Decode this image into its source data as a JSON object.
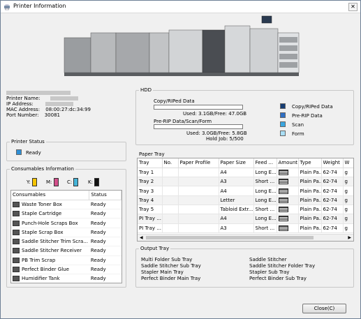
{
  "window": {
    "title": "Printer Information",
    "close_glyph": "✕"
  },
  "printer_info": {
    "name_label": "Printer Name:",
    "ip_label": "IP Address:",
    "mac_label": "MAC Address:",
    "mac_value": "08:00:27:dc:34:99",
    "port_label": "Port Number:",
    "port_value": "30081"
  },
  "printer_status": {
    "title": "Printer Status",
    "value": "Ready",
    "color": "#2e8fd6"
  },
  "consumables_info": {
    "title": "Consumables Information",
    "toners": [
      {
        "label": "Y:",
        "color": "#f5c400"
      },
      {
        "label": "M:",
        "color": "#d24f8a"
      },
      {
        "label": "C:",
        "color": "#45b4d8"
      },
      {
        "label": "K:",
        "color": "#111111"
      }
    ],
    "columns": [
      "Consumables",
      "Status"
    ],
    "rows": [
      {
        "name": "Waste Toner Box",
        "status": "Ready"
      },
      {
        "name": "Staple Cartridge",
        "status": "Ready"
      },
      {
        "name": "Punch-Hole Scraps Box",
        "status": "Ready"
      },
      {
        "name": "Staple Scrap Box",
        "status": "Ready"
      },
      {
        "name": "Saddle Stitcher Trim Scra...",
        "status": "Ready"
      },
      {
        "name": "Saddle Stitcher Receiver",
        "status": "Ready"
      },
      {
        "name": "PB Trim Scrap",
        "status": "Ready"
      },
      {
        "name": "Perfect Binder Glue",
        "status": "Ready"
      },
      {
        "name": "Humidifier Tank",
        "status": "Ready"
      }
    ]
  },
  "hdd": {
    "title": "HDD",
    "copy_ripped_label": "Copy/RIPed Data",
    "copy_ripped_usage": "Used: 3.1GB/Free: 47.0GB",
    "prerip_label": "Pre-RIP Data/Scan/Form",
    "prerip_usage": "Used: 3.0GB/Free: 5.8GB",
    "hold_job": "Hold Job: 5/500",
    "legend": [
      {
        "label": "Copy/RIPed Data",
        "color": "#163d73"
      },
      {
        "label": "Pre-RIP Data",
        "color": "#2f6fc4"
      },
      {
        "label": "Scan",
        "color": "#3aa6e0"
      },
      {
        "label": "Form",
        "color": "#a9def5"
      }
    ]
  },
  "paper_tray": {
    "title": "Paper Tray",
    "columns": [
      "Tray",
      "No.",
      "Paper Profile",
      "Paper Size",
      "Feed ...",
      "Amount",
      "Type",
      "Weight",
      "W"
    ],
    "rows": [
      {
        "tray": "Tray 1",
        "no": "",
        "profile": "",
        "size": "A4",
        "feed": "Long E...",
        "type": "Plain Pa...",
        "weight": "62-74",
        "w": "g"
      },
      {
        "tray": "Tray 2",
        "no": "",
        "profile": "",
        "size": "A3",
        "feed": "Short ...",
        "type": "Plain Pa...",
        "weight": "62-74",
        "w": "g"
      },
      {
        "tray": "Tray 3",
        "no": "",
        "profile": "",
        "size": "A4",
        "feed": "Long E...",
        "type": "Plain Pa...",
        "weight": "62-74",
        "w": "g"
      },
      {
        "tray": "Tray 4",
        "no": "",
        "profile": "",
        "size": "Letter",
        "feed": "Long E...",
        "type": "Plain Pa...",
        "weight": "62-74",
        "w": "g"
      },
      {
        "tray": "Tray 5",
        "no": "",
        "profile": "",
        "size": "Tabloid Extr...",
        "feed": "Short ...",
        "type": "Plain Pa...",
        "weight": "62-74",
        "w": "g"
      },
      {
        "tray": "PI Tray ...",
        "no": "",
        "profile": "",
        "size": "A4",
        "feed": "Long E...",
        "type": "Plain Pa...",
        "weight": "62-74",
        "w": "g"
      },
      {
        "tray": "PI Tray ...",
        "no": "",
        "profile": "",
        "size": "A3",
        "feed": "Short ...",
        "type": "Plain Pa...",
        "weight": "62-74",
        "w": "g"
      }
    ]
  },
  "output_tray": {
    "title": "Output Tray",
    "left": [
      "Multi Folder Sub Tray",
      "Saddle Stitcher Sub Tray",
      "Stapler Main Tray",
      "Perfect Binder Main Tray"
    ],
    "right": [
      "Saddle Stitcher",
      "Saddle Stitcher Folder Tray",
      "Stapler Sub Tray",
      "Perfect Binder Sub Tray"
    ]
  },
  "footer": {
    "close_label": "Close(C)"
  }
}
